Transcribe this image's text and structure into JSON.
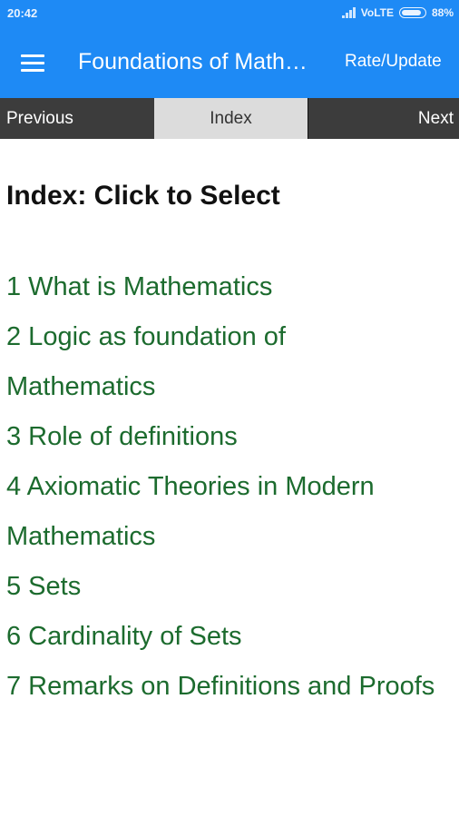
{
  "status": {
    "time": "20:42",
    "network": "VoLTE",
    "battery": "88%",
    "battery_level": 0.88
  },
  "toolbar": {
    "menu_icon": "hamburger-menu-icon",
    "title": "Foundations of Math…",
    "rate_update": "Rate/Update"
  },
  "nav": {
    "previous": "Previous",
    "index": "Index",
    "next": "Next"
  },
  "content": {
    "heading": "Index: Click to Select",
    "items": [
      "1 What is Mathematics",
      "2 Logic as foundation of Mathematics",
      "3 Role of definitions",
      "4 Axiomatic Theories in Modern Mathematics",
      "5 Sets",
      "6 Cardinality of Sets",
      "7 Remarks on Definitions and Proofs"
    ]
  },
  "colors": {
    "appbar": "#1e8af5",
    "navbar": "#3c3c3c",
    "nav_selected": "#dcdcdc",
    "link": "#1c6b2e"
  }
}
